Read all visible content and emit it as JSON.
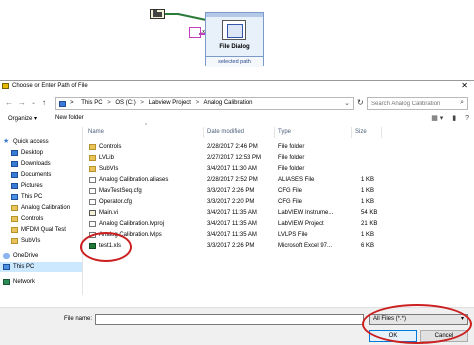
{
  "diagram": {
    "string_const": ".xls",
    "node_title": "File Dialog",
    "node_terminal": "selected path",
    "folder_const_icon": "folder-path-icon",
    "node_icon": "file-dialog-icon"
  },
  "window": {
    "title": "Choose or Enter Path of File",
    "close": "✕"
  },
  "address": {
    "back": "←",
    "forward": "→",
    "up": "↑",
    "crumbs": [
      "This PC",
      "OS (C:)",
      "Labview Project",
      "Analog Calibration"
    ],
    "separator": ">",
    "dropdown": "⌄",
    "refresh": "↻"
  },
  "search": {
    "placeholder": "Search Analog Calibration",
    "icon": "⌕"
  },
  "toolbar": {
    "organize": "Organize ▾",
    "new_folder": "New folder",
    "view_icon": "▦ ▾",
    "pane_icon": "▮",
    "help_icon": "?"
  },
  "nav": [
    {
      "label": "Quick access",
      "icon": "star"
    },
    {
      "label": "Desktop",
      "icon": "blue"
    },
    {
      "label": "Downloads",
      "icon": "blue"
    },
    {
      "label": "Documents",
      "icon": "blue"
    },
    {
      "label": "Pictures",
      "icon": "blue"
    },
    {
      "label": "This PC",
      "icon": "pc"
    },
    {
      "label": "Analog Calibration",
      "icon": "folder"
    },
    {
      "label": "Controls",
      "icon": "folder"
    },
    {
      "label": "MFDM Qual Test",
      "icon": "folder"
    },
    {
      "label": "SubVIs",
      "icon": "folder"
    },
    {
      "label": "OneDrive",
      "icon": "cloud"
    },
    {
      "label": "This PC",
      "icon": "pc"
    },
    {
      "label": "Network",
      "icon": "net"
    }
  ],
  "columns": {
    "name": "Name",
    "date": "Date modified",
    "type": "Type",
    "size": "Size",
    "sort_indicator": "^"
  },
  "files": [
    {
      "name": "Controls",
      "date": "2/28/2017 2:46 PM",
      "type": "File folder",
      "size": "",
      "icon": "folder"
    },
    {
      "name": "LVLib",
      "date": "2/27/2017 12:53 PM",
      "type": "File folder",
      "size": "",
      "icon": "folder"
    },
    {
      "name": "SubVIs",
      "date": "3/4/2017 11:30 AM",
      "type": "File folder",
      "size": "",
      "icon": "folder"
    },
    {
      "name": "Analog Calibration.aliases",
      "date": "2/28/2017 2:52 PM",
      "type": "ALIASES File",
      "size": "1 KB",
      "icon": "doc"
    },
    {
      "name": "MavTestSeq.cfg",
      "date": "3/3/2017 2:26 PM",
      "type": "CFG File",
      "size": "1 KB",
      "icon": "doc"
    },
    {
      "name": "Operator.cfg",
      "date": "3/3/2017 2:20 PM",
      "type": "CFG File",
      "size": "1 KB",
      "icon": "doc"
    },
    {
      "name": "Main.vi",
      "date": "3/4/2017 11:35 AM",
      "type": "LabVIEW Instrume...",
      "size": "54 KB",
      "icon": "vi"
    },
    {
      "name": "Analog Calibration.lvproj",
      "date": "3/4/2017 11:35 AM",
      "type": "LabVIEW Project",
      "size": "21 KB",
      "icon": "doc"
    },
    {
      "name": "Analog Calibration.lvlps",
      "date": "3/4/2017 11:35 AM",
      "type": "LVLPS File",
      "size": "1 KB",
      "icon": "doc"
    },
    {
      "name": "test1.xls",
      "date": "3/3/2017 2:26 PM",
      "type": "Microsoft Excel 97...",
      "size": "6 KB",
      "icon": "xls"
    }
  ],
  "bottom": {
    "filename_label": "File name:",
    "filename_value": "",
    "filter": "All Files (*.*)",
    "filter_dd": "▾",
    "ok": "OK",
    "cancel": "Cancel"
  },
  "colors": {
    "selection": "#cce8ff",
    "annotation": "#cc1f1f",
    "ok_border": "#0078d7"
  }
}
